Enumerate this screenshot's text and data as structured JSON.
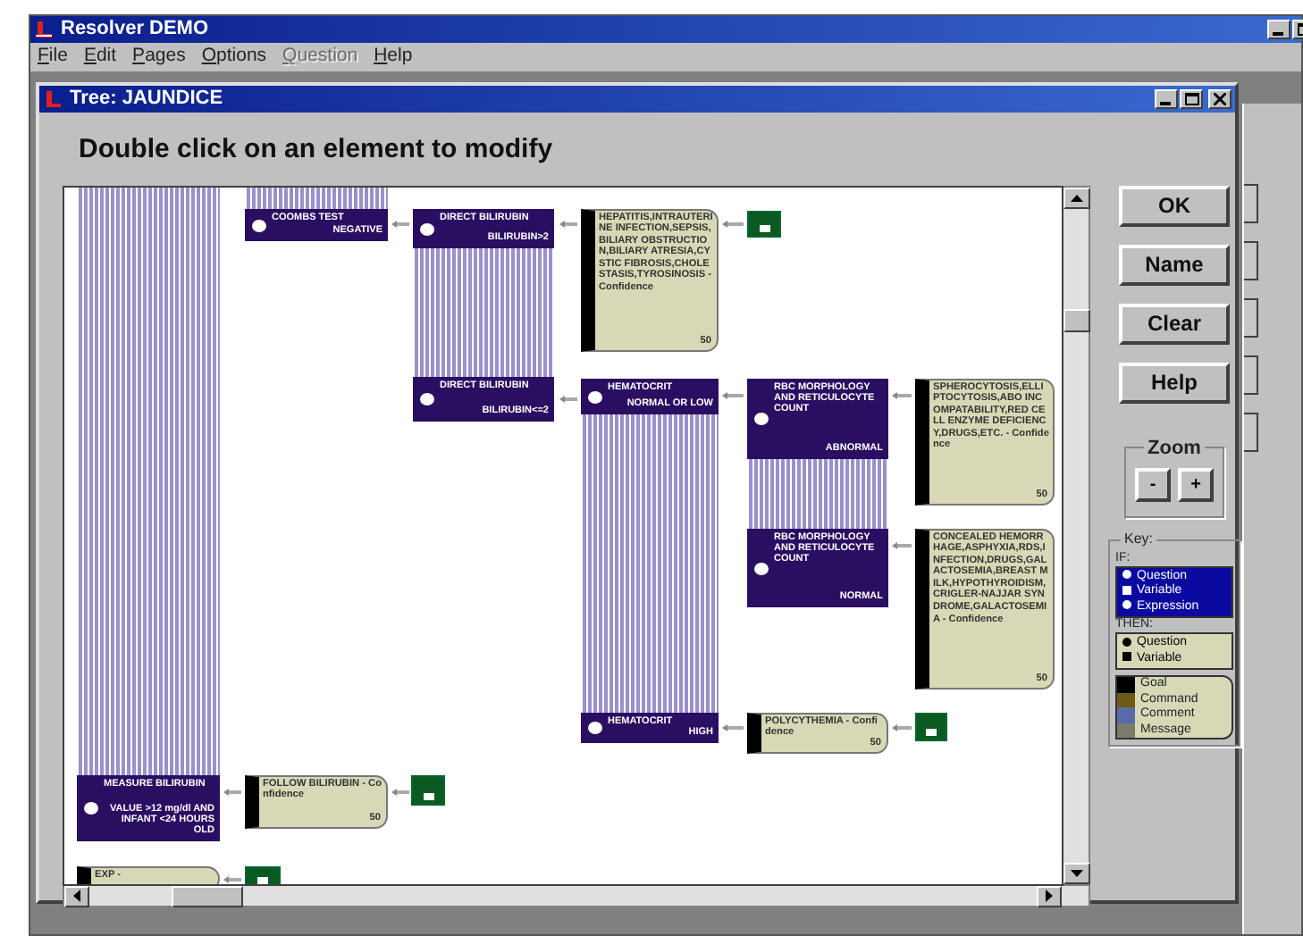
{
  "window": {
    "title": "Resolver DEMO"
  },
  "menu": [
    {
      "label": "File",
      "disabled": false
    },
    {
      "label": "Edit",
      "disabled": false
    },
    {
      "label": "Pages",
      "disabled": false
    },
    {
      "label": "Options",
      "disabled": false
    },
    {
      "label": "Question",
      "disabled": true
    },
    {
      "label": "Help",
      "disabled": false
    }
  ],
  "tree_window": {
    "title": "Tree: JAUNDICE",
    "instruction": "Double click on an element to modify"
  },
  "nodes": [
    {
      "kind": "question",
      "label": "COOMBS TEST",
      "answer": "NEGATIVE"
    },
    {
      "kind": "question",
      "label": "DIRECT BILIRUBIN",
      "answer": "BILIRUBIN>2"
    },
    {
      "kind": "conclusion",
      "text": "HEPATITIS,INTRAUTERINE INFECTION,SEPSIS,BILIARY OBSTRUCTION,BILIARY ATRESIA,CYSTIC FIBROSIS,CHOLESTASIS,TYROSINOSIS - Confidence",
      "number": "50"
    },
    {
      "kind": "goal"
    },
    {
      "kind": "question",
      "label": "DIRECT BILIRUBIN",
      "answer": "BILIRUBIN<=2"
    },
    {
      "kind": "question",
      "label": "HEMATOCRIT",
      "answer": "NORMAL OR LOW"
    },
    {
      "kind": "question",
      "label": "RBC MORPHOLOGY AND RETICULOCYTE COUNT",
      "answer": "ABNORMAL"
    },
    {
      "kind": "conclusion",
      "text": "SPHEROCYTOSIS,ELLIPTOCYTOSIS,ABO INCOMPATABILITY,RED CELL ENZYME DEFICIENCY,DRUGS,ETC. - Confidence",
      "number": "50"
    },
    {
      "kind": "question",
      "label": "RBC MORPHOLOGY AND RETICULOCYTE COUNT",
      "answer": "NORMAL"
    },
    {
      "kind": "conclusion",
      "text": "CONCEALED HEMORRHAGE,ASPHYXIA,RDS,INFECTION,DRUGS,GALACTOSEMIA,BREAST MILK,HYPOTHYROIDISM,CRIGLER-NAJJAR SYNDROME,GALACTOSEMIA - Confidence",
      "number": "50"
    },
    {
      "kind": "question",
      "label": "HEMATOCRIT",
      "answer": "HIGH"
    },
    {
      "kind": "conclusion",
      "text": "POLYCYTHEMIA - Confidence",
      "number": "50"
    },
    {
      "kind": "goal"
    },
    {
      "kind": "question",
      "label": "MEASURE BILIRUBIN",
      "answer": "VALUE >12 mg/dl AND INFANT <24 HOURS OLD"
    },
    {
      "kind": "conclusion",
      "text": "FOLLOW BILIRUBIN - Confidence",
      "number": "50"
    },
    {
      "kind": "goal"
    },
    {
      "kind": "conclusion",
      "text": "EXP -"
    },
    {
      "kind": "goal"
    }
  ],
  "buttons": [
    "OK",
    "Name",
    "Clear",
    "Help"
  ],
  "zoom": {
    "title": "Zoom",
    "buttons": [
      "-",
      "+"
    ]
  },
  "key": {
    "title": "Key:",
    "if_label": "IF:",
    "if_items": [
      {
        "kind": "dot",
        "label": "Question"
      },
      {
        "kind": "square",
        "label": "Variable"
      },
      {
        "kind": "dot",
        "label": "Expression"
      }
    ],
    "then_label": "THEN:",
    "then_items": [
      {
        "kind": "dot",
        "label": "Question"
      },
      {
        "kind": "square",
        "label": "Variable"
      }
    ],
    "types": [
      {
        "label": "Goal",
        "color": "#000000"
      },
      {
        "label": "Command",
        "color": "#6e5a12"
      },
      {
        "label": "Comment",
        "color": "#5a6aa8"
      },
      {
        "label": "Message",
        "color": "#7c7c6c"
      }
    ]
  }
}
